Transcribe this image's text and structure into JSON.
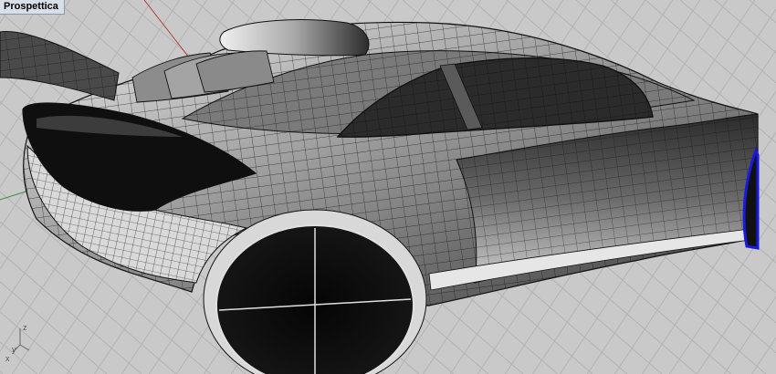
{
  "viewport": {
    "title": "Prospettica",
    "colors": {
      "background": "#c9c9c9",
      "grid": "#b3b3b3",
      "x_axis": "#b33a3a",
      "y_axis": "#3a8a3a",
      "selection": "#1a1adf",
      "mesh_wire": "#111111"
    }
  },
  "axis_widget": {
    "x": "x",
    "y": "y",
    "z": "z"
  },
  "model": {
    "icon": "car-wireframe-model"
  }
}
